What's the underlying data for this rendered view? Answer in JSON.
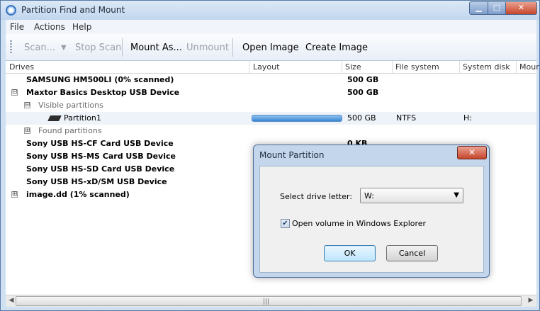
{
  "window": {
    "title": "Partition Find and Mount"
  },
  "menu": {
    "file": "File",
    "actions": "Actions",
    "help": "Help"
  },
  "toolbar": {
    "scan": "Scan...",
    "stop_scan": "Stop Scan",
    "mount_as": "Mount As...",
    "unmount": "Unmount",
    "open_image": "Open Image",
    "create_image": "Create Image"
  },
  "columns": {
    "drives": "Drives",
    "layout": "Layout",
    "size": "Size",
    "file_system": "File system",
    "system_disk": "System disk",
    "mount": "Mour"
  },
  "rows": [
    {
      "name": "SAMSUNG HM500LI  (0% scanned)",
      "size": "500 GB"
    },
    {
      "name": "Maxtor Basics Desktop USB Device",
      "size": "500 GB"
    },
    {
      "name": "Visible partitions"
    },
    {
      "name": "Partition1",
      "size": "500 GB",
      "fs": "NTFS",
      "sys": "H:",
      "progress": 1.0
    },
    {
      "name": "Found partitions"
    },
    {
      "name": "Sony USB   HS-CF Card USB Device",
      "size": "0 KB"
    },
    {
      "name": "Sony USB   HS-MS Card USB Device"
    },
    {
      "name": "Sony USB   HS-SD Card USB Device"
    },
    {
      "name": "Sony USB   HS-xD/SM USB Device"
    },
    {
      "name": "image.dd  (1% scanned)"
    }
  ],
  "tree": {
    "expanded": "⊟",
    "collapsed": "⊞"
  },
  "dialog": {
    "title": "Mount Partition",
    "close": "✕",
    "drive_label": "Select drive letter:",
    "drive_value": "W:",
    "open_explorer_label": "Open volume in Windows Explorer",
    "open_explorer_checked": true,
    "ok": "OK",
    "cancel": "Cancel"
  },
  "colors": {
    "accent": "#3a86d2",
    "close": "#c7452a"
  }
}
